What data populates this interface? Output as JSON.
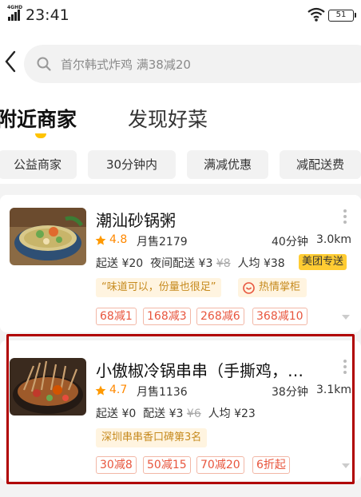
{
  "status_bar": {
    "network": "4GHD",
    "time": "23:41",
    "battery": "51"
  },
  "search": {
    "placeholder": "首尔韩式炸鸡 满38减20"
  },
  "tabs": [
    {
      "label": "附近商家",
      "active": true
    },
    {
      "label": "发现好菜",
      "active": false
    }
  ],
  "filters": [
    "公益商家",
    "30分钟内",
    "满减优惠",
    "减配送费"
  ],
  "stores": [
    {
      "name": "潮汕砂锅粥",
      "rating": "4.8",
      "sales": "月售2179",
      "time": "40分钟",
      "distance": "3.0km",
      "min_order": "起送 ¥20",
      "delivery_label": "夜间配送",
      "delivery_fee": "¥3",
      "delivery_fee_original": "¥8",
      "avg_price": "人均 ¥38",
      "delivery_badge": "美团专送",
      "review": "“味道可以，份量也很足”",
      "hot_tag": "热情掌柜",
      "promos": [
        "68减1",
        "168减3",
        "268减6",
        "368减10"
      ]
    },
    {
      "name": "小傲椒冷锅串串（手撕鸡，…",
      "rating": "4.7",
      "sales": "月售1136",
      "time": "38分钟",
      "distance": "3.1km",
      "min_order": "起送 ¥0",
      "delivery_label": "配送",
      "delivery_fee": "¥3",
      "delivery_fee_original": "¥6",
      "avg_price": "人均 ¥23",
      "rank_tag": "深圳串串香口碑第3名",
      "promos": [
        "30减8",
        "50减15",
        "70减20",
        "6折起"
      ]
    }
  ],
  "colors": {
    "accent": "#ffc300",
    "rating": "#ff8800",
    "promo": "#e8553d",
    "highlight": "#b00000"
  }
}
